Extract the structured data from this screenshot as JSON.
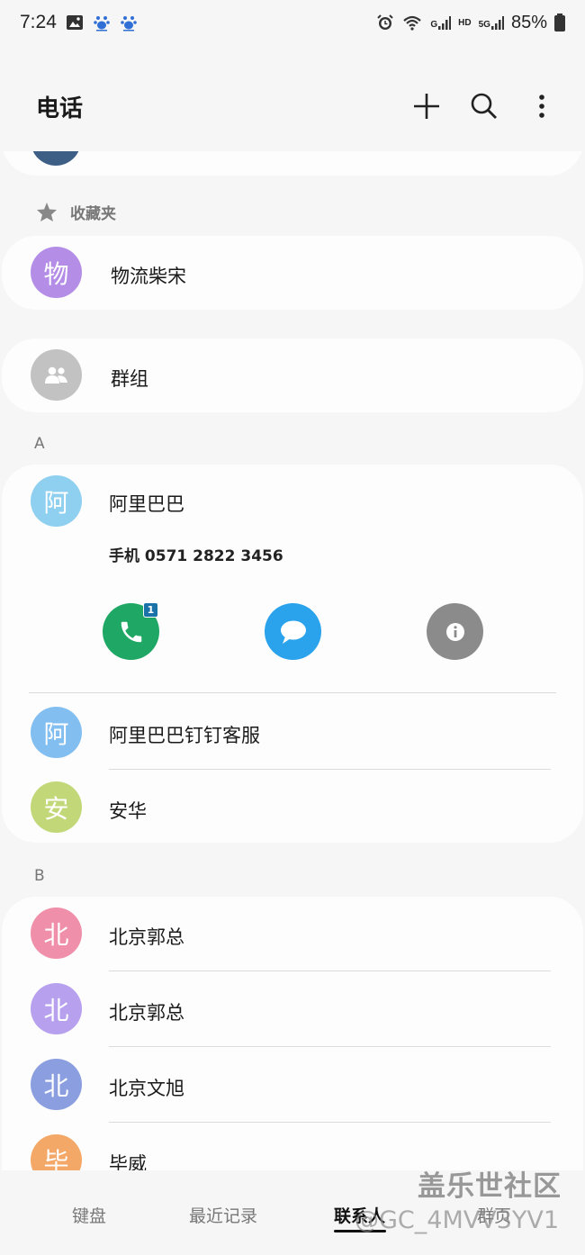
{
  "status_bar": {
    "time": "7:24",
    "battery": "85%",
    "net_hd": "HD",
    "net_5g": "5G",
    "net_g": "G"
  },
  "app_bar": {
    "title": "电话",
    "icons": [
      "add-icon",
      "search-icon",
      "more-vert-icon"
    ]
  },
  "partial_contact": {
    "name": ""
  },
  "favorites": {
    "header": "收藏夹",
    "items": [
      {
        "name": "物流柴宋",
        "initial": "物",
        "color": "#b48ee6"
      }
    ]
  },
  "groups": {
    "label": "群组",
    "color": "#c2c2c2"
  },
  "sections": [
    {
      "letter": "A",
      "contacts": [
        {
          "name": "阿里巴巴",
          "initial": "阿",
          "color": "#8fd0f0",
          "expanded": true,
          "phone": "手机 0571 2822 3456",
          "call_badge": "1",
          "actions": [
            "call",
            "message",
            "info"
          ]
        },
        {
          "name": "阿里巴巴钉钉客服",
          "initial": "阿",
          "color": "#82bff0"
        },
        {
          "name": "安华",
          "initial": "安",
          "color": "#c2d878"
        }
      ]
    },
    {
      "letter": "B",
      "contacts": [
        {
          "name": "北京郭总",
          "initial": "北",
          "color": "#ef8fa9"
        },
        {
          "name": "北京郭总",
          "initial": "北",
          "color": "#b7a0ee"
        },
        {
          "name": "北京文旭",
          "initial": "北",
          "color": "#8b9fe0"
        },
        {
          "name": "毕威",
          "initial": "毕",
          "color": "#f4a868"
        }
      ]
    }
  ],
  "bottom_nav": {
    "tabs": [
      "键盘",
      "最近记录",
      "联系人",
      "群页"
    ],
    "active_index": 2
  },
  "watermark": {
    "line1": "盖乐世社区",
    "line2": "@GC_4MVV3YV1"
  }
}
